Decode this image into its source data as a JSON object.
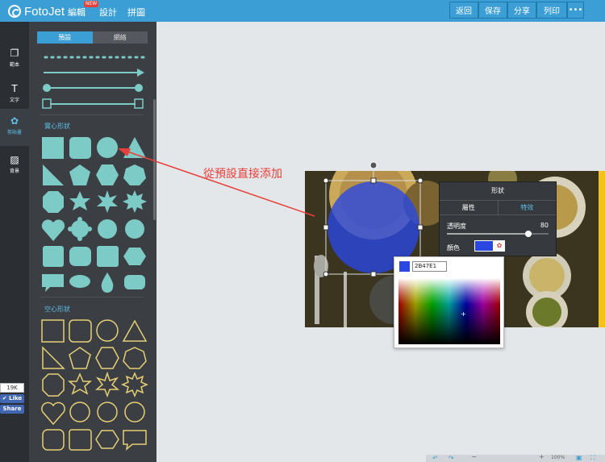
{
  "app": {
    "logo_text": "FotoJet"
  },
  "nav": {
    "edit": "編輯",
    "new_badge": "NEW",
    "design": "設計",
    "collage": "拼圖"
  },
  "toolbar": {
    "back": "返回",
    "save": "保存",
    "share": "分享",
    "print": "列印",
    "more": "•••"
  },
  "sidebar": {
    "items": [
      {
        "label": "範本",
        "icon": "template-icon"
      },
      {
        "label": "文字",
        "icon": "text-icon"
      },
      {
        "label": "剪貼畫",
        "icon": "clipart-icon"
      },
      {
        "label": "背景",
        "icon": "background-icon"
      }
    ]
  },
  "panel": {
    "tabs": [
      "預設",
      "網絡"
    ],
    "solid_title": "實心形狀",
    "outline_title": "空心形狀"
  },
  "annotation": {
    "text": "從預設直接添加"
  },
  "shape_popup": {
    "title": "形狀",
    "tab_properties": "屬性",
    "tab_effects": "特效",
    "opacity_label": "透明度",
    "opacity_value": "80",
    "color_label": "顏色"
  },
  "color_picker": {
    "hex_value": "2B47E1"
  },
  "colors": {
    "accent": "#3b9fd6",
    "shape_fill": "#2B47E1",
    "teal": "#7dcbc6",
    "gold": "#e6cf74"
  },
  "social": {
    "count": "19K",
    "like": "Like",
    "share": "Share"
  },
  "zoom": {
    "value": "100%"
  }
}
